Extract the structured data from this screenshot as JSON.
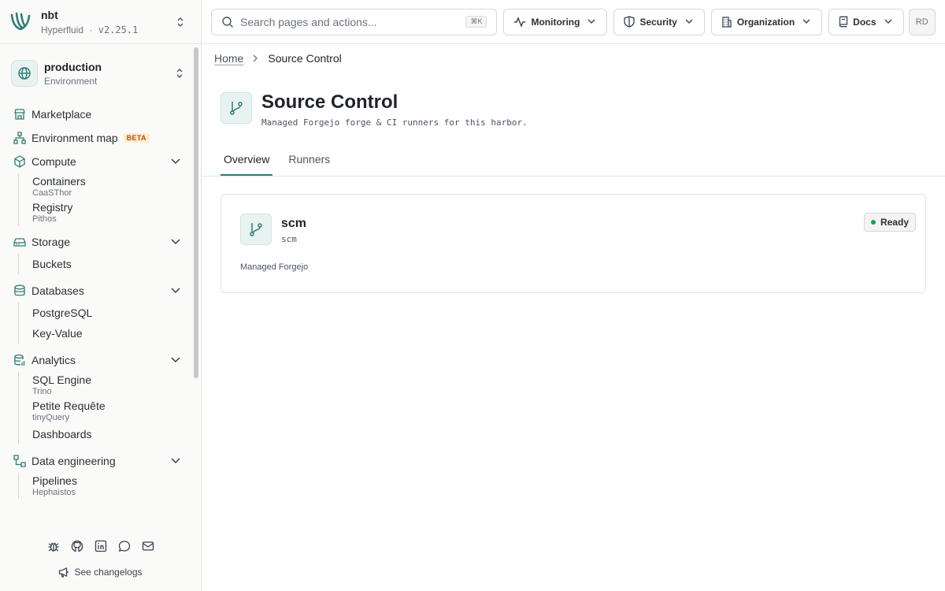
{
  "brand": {
    "name": "nbt",
    "org": "Hyperfluid",
    "separator": "·",
    "version": "v2.25.1"
  },
  "environment": {
    "name": "production",
    "label": "Environment"
  },
  "nav": {
    "marketplace": "Marketplace",
    "environment_map": "Environment map",
    "beta": "BETA",
    "compute": {
      "label": "Compute",
      "items": [
        {
          "label": "Containers",
          "sub": "CaaSThor"
        },
        {
          "label": "Registry",
          "sub": "Pithos"
        }
      ]
    },
    "storage": {
      "label": "Storage",
      "items": [
        {
          "label": "Buckets"
        }
      ]
    },
    "databases": {
      "label": "Databases",
      "items": [
        {
          "label": "PostgreSQL"
        },
        {
          "label": "Key-Value"
        }
      ]
    },
    "analytics": {
      "label": "Analytics",
      "items": [
        {
          "label": "SQL Engine",
          "sub": "Trino"
        },
        {
          "label": "Petite Requête",
          "sub": "tinyQuery"
        },
        {
          "label": "Dashboards"
        }
      ]
    },
    "data_engineering": {
      "label": "Data engineering",
      "items": [
        {
          "label": "Pipelines",
          "sub": "Hephaistos"
        }
      ]
    }
  },
  "footer": {
    "changelog": "See changelogs",
    "icons": [
      "bug-icon",
      "github-icon",
      "linkedin-icon",
      "chat-icon",
      "mail-icon"
    ]
  },
  "search": {
    "placeholder": "Search pages and actions...",
    "shortcut": "⌘K"
  },
  "topnav": {
    "monitoring": "Monitoring",
    "security": "Security",
    "organization": "Organization",
    "docs": "Docs",
    "avatar": "RD"
  },
  "breadcrumb": {
    "home": "Home",
    "current": "Source Control"
  },
  "page": {
    "title": "Source Control",
    "description": "Managed Forgejo forge & CI runners for this harbor."
  },
  "tabs": {
    "overview": "Overview",
    "runners": "Runners"
  },
  "card": {
    "title": "scm",
    "subtitle": "scm",
    "description": "Managed Forgejo",
    "status": "Ready"
  },
  "colors": {
    "accent": "#2f7c74",
    "status_ready": "#16a34a",
    "beta_text": "#b45309"
  }
}
